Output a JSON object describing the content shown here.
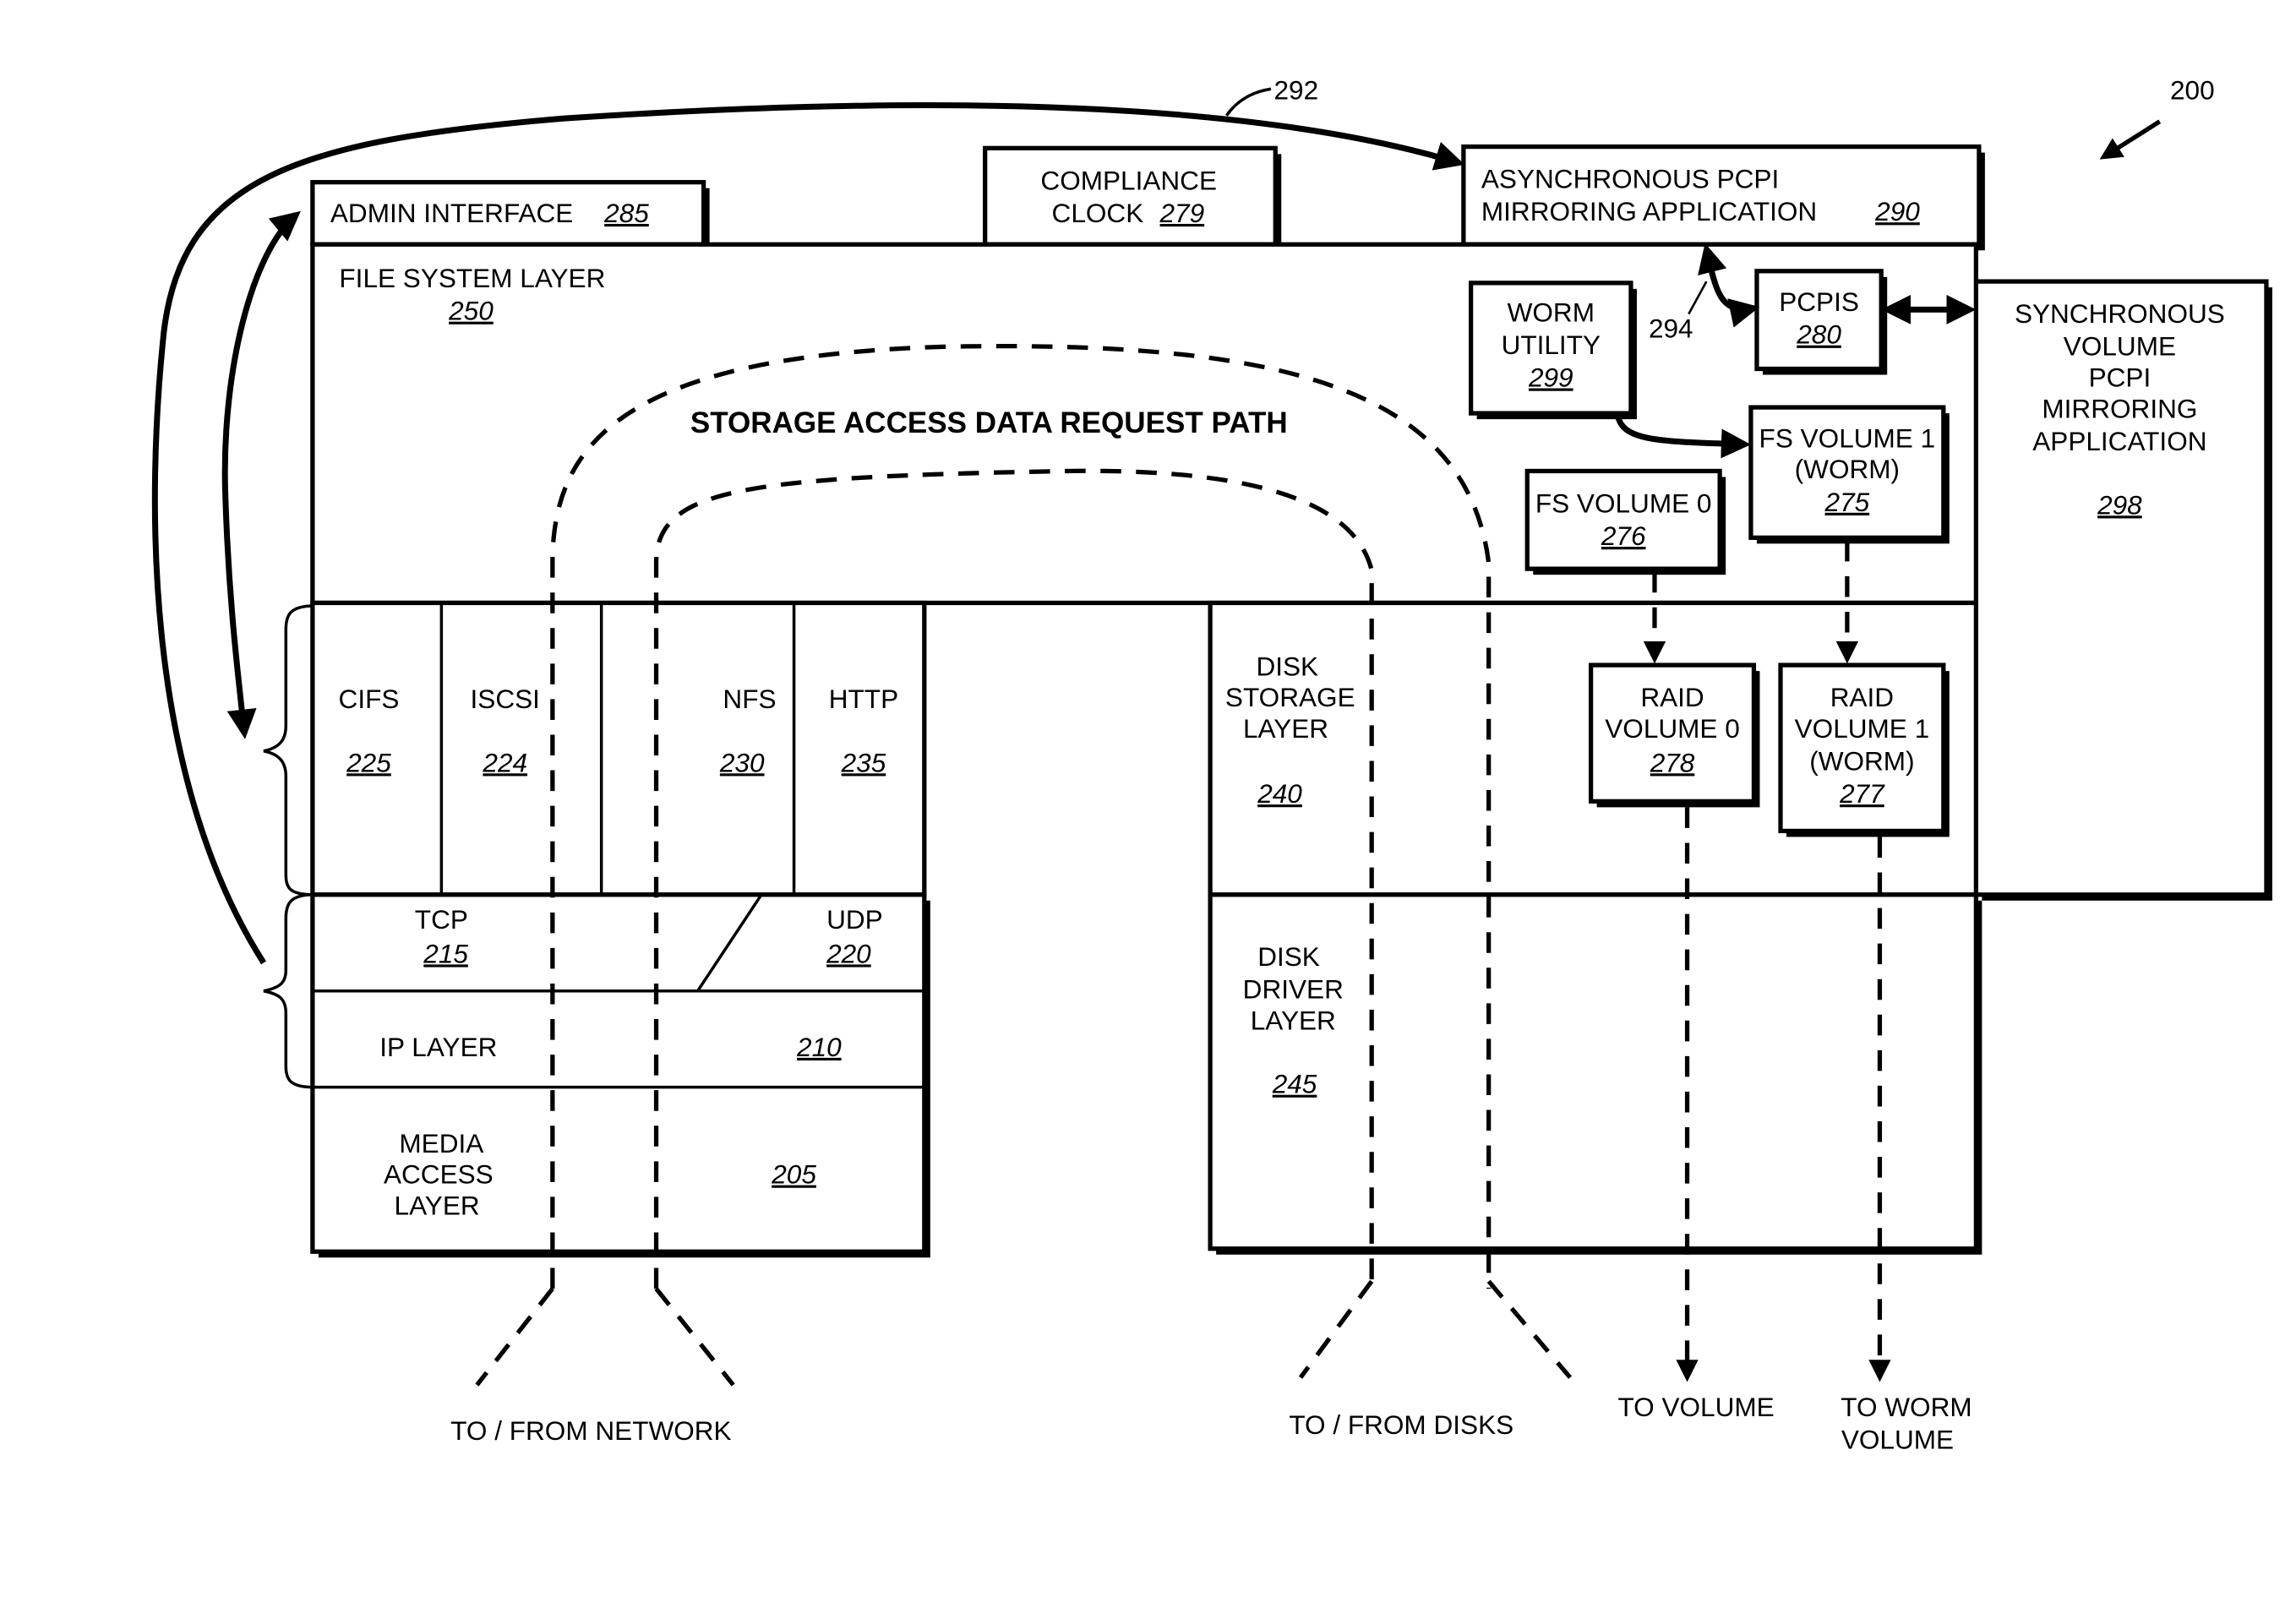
{
  "figure": {
    "ref": "200",
    "path_title": "STORAGE ACCESS DATA REQUEST PATH",
    "arrow_refs": {
      "admin_to_async": "292",
      "pcpis_to_async": "294"
    }
  },
  "top_boxes": {
    "admin": {
      "label": "ADMIN INTERFACE",
      "ref": "285"
    },
    "clock": {
      "line1": "COMPLIANCE",
      "line2": "CLOCK",
      "ref": "279"
    },
    "async": {
      "line1": "ASYNCHRONOUS PCPI",
      "line2": "MIRRORING APPLICATION",
      "ref": "290"
    }
  },
  "file_system": {
    "label": "FILE SYSTEM LAYER",
    "ref": "250",
    "worm_utility": {
      "line1": "WORM",
      "line2": "UTILITY",
      "ref": "299"
    },
    "pcpis": {
      "line1": "PCPIS",
      "ref": "280"
    },
    "fs_volume_1": {
      "line1": "FS VOLUME 1",
      "line2": "(WORM)",
      "ref": "275"
    },
    "fs_volume_0": {
      "line1": "FS VOLUME 0",
      "ref": "276"
    }
  },
  "sync_app": {
    "lines": [
      "SYNCHRONOUS",
      "VOLUME",
      "PCPI",
      "MIRRORING",
      "APPLICATION"
    ],
    "ref": "298"
  },
  "protocols": [
    {
      "label": "CIFS",
      "ref": "225"
    },
    {
      "label": "ISCSI",
      "ref": "224"
    },
    {
      "label": "NFS",
      "ref": "230"
    },
    {
      "label": "HTTP",
      "ref": "235"
    }
  ],
  "network_stack": {
    "tcp": {
      "label": "TCP",
      "ref": "215"
    },
    "udp": {
      "label": "UDP",
      "ref": "220"
    },
    "ip": {
      "label": "IP LAYER",
      "ref": "210"
    },
    "media": {
      "line1": "MEDIA",
      "line2": "ACCESS",
      "line3": "LAYER",
      "ref": "205"
    }
  },
  "disk_storage": {
    "line1": "DISK",
    "line2": "STORAGE",
    "line3": "LAYER",
    "ref": "240",
    "raid0": {
      "line1": "RAID",
      "line2": "VOLUME 0",
      "ref": "278"
    },
    "raid1": {
      "line1": "RAID",
      "line2": "VOLUME 1",
      "line3": "(WORM)",
      "ref": "277"
    }
  },
  "disk_driver": {
    "line1": "DISK",
    "line2": "DRIVER",
    "line3": "LAYER",
    "ref": "245"
  },
  "bottom_labels": {
    "network": "TO / FROM NETWORK",
    "disks": "TO / FROM DISKS",
    "volume": "TO VOLUME",
    "worm_line1": "TO WORM",
    "worm_line2": "VOLUME"
  }
}
